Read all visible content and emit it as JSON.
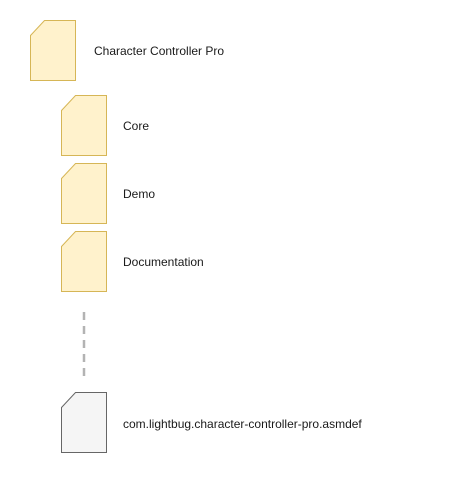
{
  "colors": {
    "folder_fill": "#fff2cc",
    "folder_stroke": "#d6b656",
    "file_fill": "#f5f5f5",
    "file_stroke": "#666666",
    "connector": "#b3b3b3"
  },
  "root": {
    "icon": "folder-icon",
    "label": "Character Controller Pro"
  },
  "children": [
    {
      "icon": "folder-icon",
      "label": "Core"
    },
    {
      "icon": "folder-icon",
      "label": "Demo"
    },
    {
      "icon": "folder-icon",
      "label": "Documentation"
    },
    {
      "icon": "file-icon",
      "label": "com.lightbug.character-controller-pro.asmdef"
    }
  ]
}
